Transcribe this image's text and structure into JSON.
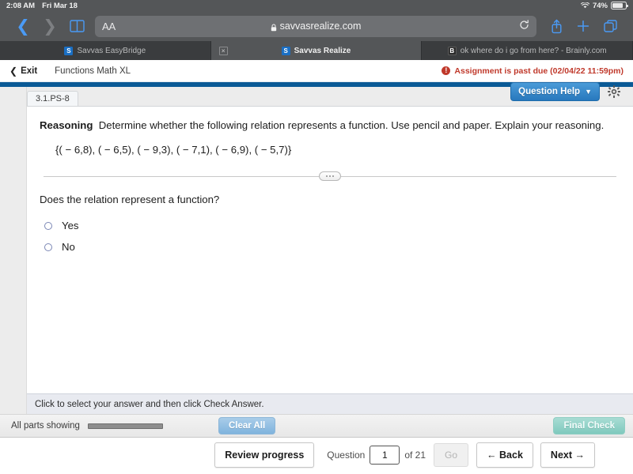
{
  "statusbar": {
    "time": "2:08 AM",
    "date": "Fri Mar 18",
    "battery_pct": "74%",
    "wifi_icon": "wifi-icon",
    "battery_icon": "battery-icon"
  },
  "browser": {
    "back_icon": "chevron-left-icon",
    "forward_icon": "chevron-right-icon",
    "bookmarks_icon": "book-icon",
    "text_size_label": "AA",
    "lock_icon": "lock-icon",
    "url": "savvasrealize.com",
    "reload_icon": "reload-icon",
    "share_icon": "share-icon",
    "newtab_icon": "plus-icon",
    "tabs_icon": "tabs-overview-icon"
  },
  "tabs": [
    {
      "title": "Savvas EasyBridge",
      "favicon": "savvas-favicon",
      "active": false,
      "close_icon": "close-icon"
    },
    {
      "title": "Savvas Realize",
      "favicon": "savvas-favicon",
      "active": true,
      "close_icon": "close-icon"
    },
    {
      "title": "ok where do i go from here? - Brainly.com",
      "favicon": "brainly-favicon",
      "active": false,
      "close_icon": "close-icon"
    }
  ],
  "appheader": {
    "exit_label": "Exit",
    "exit_icon": "chevron-left-icon",
    "title": "Functions Math XL",
    "alert_icon": "alert-icon",
    "alert_text": "Assignment is past due (02/04/22 11:59pm)",
    "alert_color": "#c0392b"
  },
  "question": {
    "id_tab": "3.1.PS-8",
    "help_label": "Question Help",
    "help_caret_icon": "caret-down-icon",
    "settings_icon": "gear-icon",
    "prompt_bold": "Reasoning",
    "prompt_text": "Determine whether the following relation represents a function. Use pencil and paper. Explain your reasoning.",
    "relation": "{( − 6,8), ( − 6,5), ( − 9,3), ( − 7,1), ( − 6,9), ( − 5,7)}",
    "divider_handle_icon": "drag-handle-icon",
    "sub_question": "Does the relation represent a function?",
    "choices": [
      {
        "label": "Yes",
        "selected": false
      },
      {
        "label": "No",
        "selected": false
      }
    ],
    "hint": "Click to select your answer and then click Check Answer."
  },
  "actionbar": {
    "parts_label": "All parts showing",
    "parts_progress": 100,
    "clear_label": "Clear All",
    "final_label": "Final Check"
  },
  "bottomnav": {
    "review_label": "Review progress",
    "question_label": "Question",
    "question_value": "1",
    "of_label": "of 21",
    "go_label": "Go",
    "back_label": "Back",
    "back_icon": "arrow-left-icon",
    "next_label": "Next",
    "next_icon": "arrow-right-icon"
  },
  "colors": {
    "chrome": "#545658",
    "tabbar": "#3a3c3e",
    "accent_blue": "#0a5a96",
    "help_blue": "#2e86c8",
    "alert_red": "#c0392b"
  }
}
